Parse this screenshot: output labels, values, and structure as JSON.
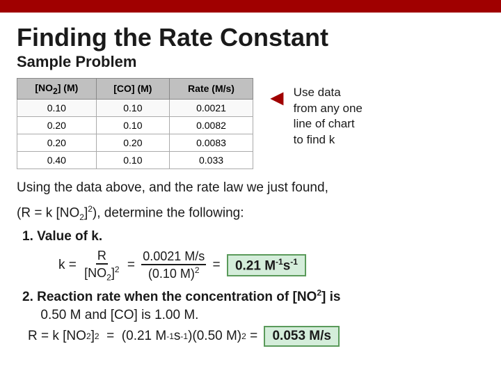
{
  "topBar": {
    "color": "#a00000"
  },
  "title": "Finding the Rate Constant",
  "subtitle": "Sample Problem",
  "table": {
    "headers": [
      "[NO₂] (M)",
      "[CO] (M)",
      "Rate (M/s)"
    ],
    "rows": [
      [
        "0.10",
        "0.10",
        "0.0021"
      ],
      [
        "0.20",
        "0.10",
        "0.0082"
      ],
      [
        "0.20",
        "0.20",
        "0.0083"
      ],
      [
        "0.40",
        "0.10",
        "0.033"
      ]
    ]
  },
  "note": {
    "arrow": "◄",
    "lines": [
      "Use data",
      "from any one",
      "line of chart",
      "to find k"
    ]
  },
  "body1": "Using the data above, and the rate law we just found,",
  "body2": "(R = k [NO₂]²), determine the following:",
  "step1_label": "1.  Value of k.",
  "step1_math": "k = R / [NO₂]² = 0.0021 M/s / (0.10 M)² = 0.21 M⁻¹s⁻¹",
  "step1_result": "0.21 M⁻¹s⁻¹",
  "step2_label": "2.  Reaction rate when the concentration of [NO²] is",
  "step2_sub": "     0.50 M and [CO] is 1.00 M.",
  "step2_math": "R = k [NO₂]² = (0.21 M⁻¹s⁻¹)(0.50 M)² = 0.053 M/s",
  "step2_result": "0.053 M/s"
}
